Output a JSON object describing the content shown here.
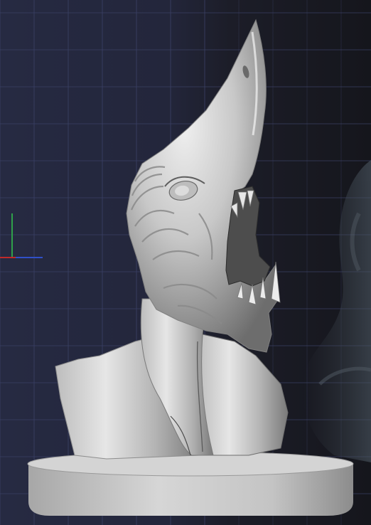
{
  "viewport": {
    "kind": "3d-sculpt-viewport",
    "subject": "creature-bust-sculpt",
    "colors": {
      "background_left": "#262a42",
      "background_right": "#15161c",
      "grid_line": "#3b4166",
      "axis_x": "#c02a2a",
      "axis_y": "#2fa04a",
      "axis_z": "#3050c8",
      "clay_light": "#d9d9d9",
      "clay_mid": "#a9a9a9",
      "clay_shadow": "#555555"
    },
    "grid": true,
    "axis_gizmo": true,
    "reference_image_overlay": true,
    "base_pedestal": true
  }
}
